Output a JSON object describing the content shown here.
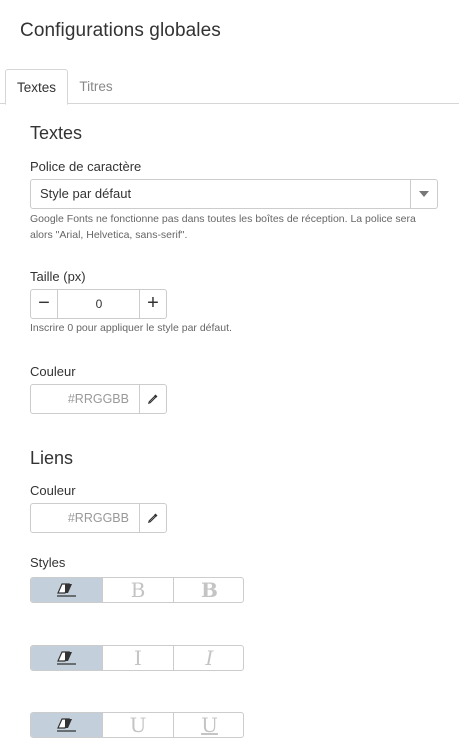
{
  "header": {
    "title": "Configurations globales"
  },
  "tabs": [
    {
      "label": "Textes",
      "active": true
    },
    {
      "label": "Titres",
      "active": false
    }
  ],
  "texts_section": {
    "title": "Textes",
    "font": {
      "label": "Police de caractère",
      "selected": "Style par défaut",
      "help": "Google Fonts ne fonctionne pas dans toutes les boîtes de réception. La police sera alors \"Arial, Helvetica, sans-serif\"."
    },
    "size": {
      "label": "Taille (px)",
      "value": "0",
      "minus": "−",
      "plus": "+",
      "help": "Inscrire 0 pour appliquer le style par défaut."
    },
    "color": {
      "label": "Couleur",
      "placeholder": "#RRGGBB"
    }
  },
  "links_section": {
    "title": "Liens",
    "color": {
      "label": "Couleur",
      "placeholder": "#RRGGBB"
    },
    "styles": {
      "label": "Styles",
      "groups": [
        {
          "name": "bold",
          "options": [
            "clear",
            "B",
            "B"
          ],
          "selected": 0
        },
        {
          "name": "italic",
          "options": [
            "clear",
            "I",
            "I"
          ],
          "selected": 0
        },
        {
          "name": "underline",
          "options": [
            "clear",
            "U",
            "U"
          ],
          "selected": 0
        }
      ]
    }
  },
  "colors": {
    "selected_segment": "#c3d0db",
    "border": "#cccccc",
    "muted_text": "#999999"
  },
  "icons": {
    "select_arrow": "caret-down-icon",
    "picker": "eyedropper-icon",
    "clear": "eraser-icon"
  }
}
